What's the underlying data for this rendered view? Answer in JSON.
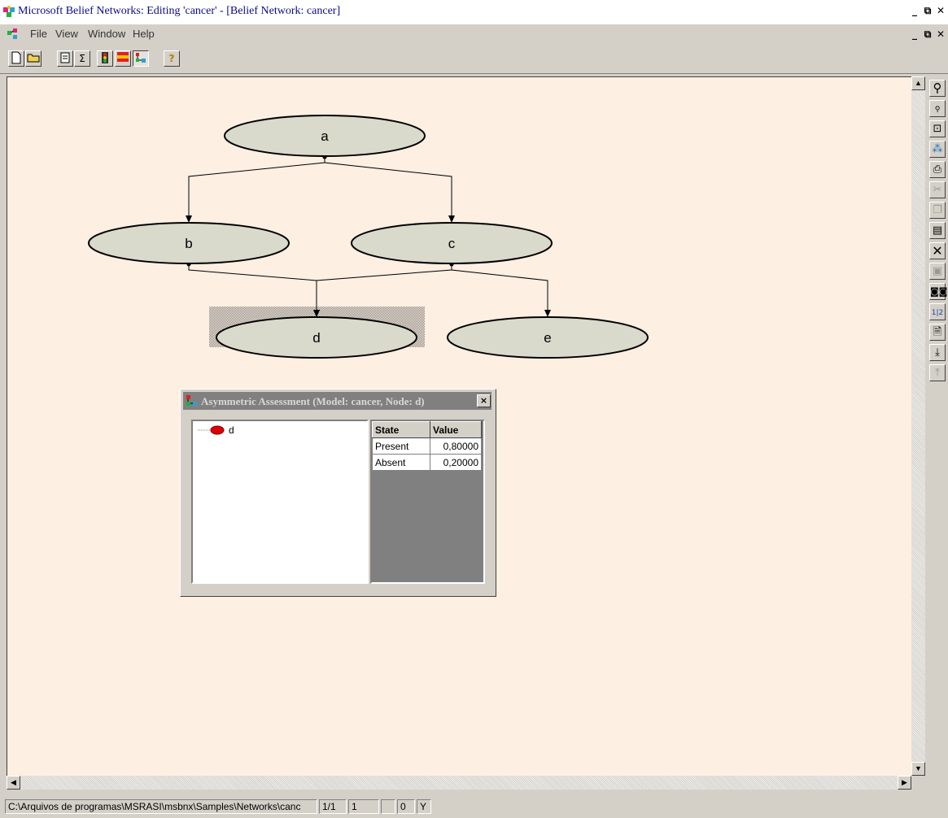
{
  "app": {
    "title": "Microsoft Belief Networks: Editing 'cancer' - [Belief Network:  cancer]"
  },
  "menu": [
    "File",
    "View",
    "Window",
    "Help"
  ],
  "toolbar": {
    "buttons": [
      "new-file",
      "open-folder",
      "properties",
      "sigma",
      "traffic-light",
      "table-view",
      "network-view",
      "help"
    ]
  },
  "network": {
    "node_color": "#d9d9cc",
    "canvas_color": "#fdefe2",
    "nodes": [
      {
        "id": "a",
        "label": "a"
      },
      {
        "id": "b",
        "label": "b"
      },
      {
        "id": "c",
        "label": "c"
      },
      {
        "id": "d",
        "label": "d",
        "selected": true
      },
      {
        "id": "e",
        "label": "e"
      }
    ],
    "edges": [
      {
        "from": "a",
        "to": "b"
      },
      {
        "from": "a",
        "to": "c"
      },
      {
        "from": "b",
        "to": "d"
      },
      {
        "from": "c",
        "to": "d"
      },
      {
        "from": "c",
        "to": "e"
      }
    ]
  },
  "dialog": {
    "title": "Asymmetric Assessment (Model: cancer,  Node: d)",
    "close_label": "×",
    "tree_node": "d",
    "table": {
      "headers": [
        "State",
        "Value"
      ],
      "rows": [
        {
          "state": "Present",
          "value": "0,80000"
        },
        {
          "state": "Absent",
          "value": "0,20000"
        }
      ]
    }
  },
  "side_tools": [
    "zoom-in",
    "zoom-out",
    "zoom-fit",
    "hierarchy",
    "print",
    "cut",
    "copy",
    "paste",
    "delete",
    "save",
    "find",
    "numbering",
    "properties",
    "move-down",
    "move-up"
  ],
  "status": {
    "path": "C:\\Arquivos de programas\\MSRASI\\msbnx\\Samples\\Networks\\canc",
    "page": "1/1",
    "field2": "1",
    "field3": "",
    "field4": "0",
    "field5": "Y"
  }
}
